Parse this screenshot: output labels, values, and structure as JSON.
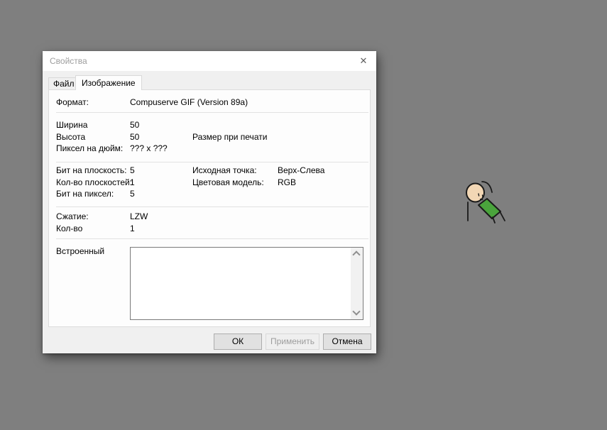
{
  "window": {
    "title": "Свойства",
    "tabs": [
      {
        "label": "Файл",
        "active": false
      },
      {
        "label": "Изображение",
        "active": true
      }
    ],
    "fields": {
      "format": {
        "label": "Формат:",
        "value": "Compuserve GIF (Version 89a)"
      },
      "width": {
        "label": "Ширина",
        "value": "50"
      },
      "height": {
        "label": "Высота",
        "value": "50"
      },
      "print_size": {
        "label": "Размер при печати"
      },
      "dpi": {
        "label": "Пиксел на дюйм:",
        "value": "??? x ???"
      },
      "bits_per_plane": {
        "label": "Бит на плоскость:",
        "value": "5"
      },
      "plane_count": {
        "label": "Кол-во плоскостей:",
        "value": "1"
      },
      "bits_per_pixel": {
        "label": "Бит на пиксел:",
        "value": "5"
      },
      "origin": {
        "label": "Исходная точка:",
        "value": "Верх-Слева"
      },
      "color_model": {
        "label": "Цветовая модель:",
        "value": "RGB"
      },
      "compression": {
        "label": "Сжатие:",
        "value": "LZW"
      },
      "count": {
        "label": "Кол-во",
        "value": "1"
      },
      "embedded": {
        "label": "Встроенный",
        "value": ""
      }
    },
    "buttons": {
      "ok": "ОК",
      "apply": "Применить",
      "cancel": "Отмена"
    },
    "apply_disabled": true
  },
  "icons": {
    "close": "✕",
    "scroll_up": "chevron-up",
    "scroll_down": "chevron-down"
  },
  "colors": {
    "desktop_bg": "#7f7f7f",
    "dialog_bg": "#f0f0f0",
    "titlebar_bg": "#ffffff",
    "inactive_title_text": "#9e9e9e",
    "character_shirt_green": "#4aa43c",
    "character_skin": "#f2d7b5"
  }
}
